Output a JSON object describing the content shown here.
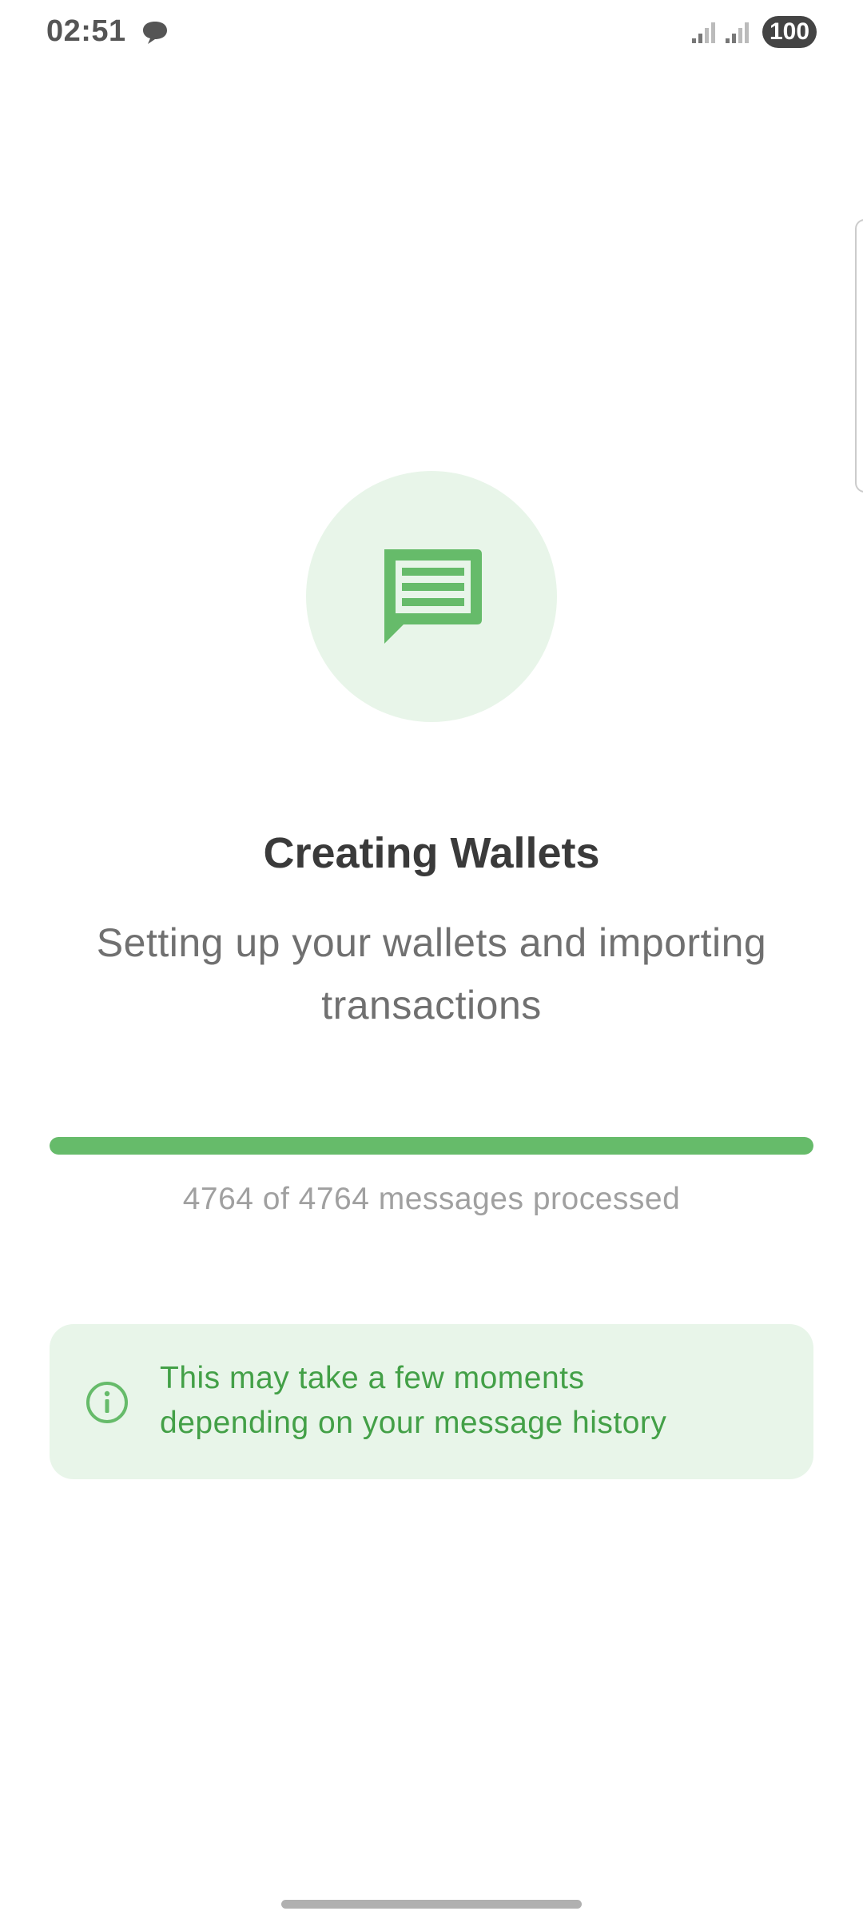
{
  "status_bar": {
    "time": "02:51",
    "battery": "100",
    "icons": [
      "chat-bubble-icon",
      "signal-icon",
      "signal-icon"
    ]
  },
  "main": {
    "icon": "message-icon",
    "title": "Creating Wallets",
    "subtitle": "Setting up your wallets and importing transactions",
    "progress": {
      "processed": 4764,
      "total": 4764,
      "fraction": 1.0,
      "text": "4764 of 4764 messages processed"
    },
    "info": {
      "icon": "info-icon",
      "text_line1": "This may take a few moments",
      "text_line2": "depending on your message history"
    }
  },
  "colors": {
    "accent": "#66bb6a",
    "accent_light": "#e8f5e9",
    "info_text": "#43a047",
    "title": "#3a3a3a",
    "subtitle": "#707070"
  }
}
